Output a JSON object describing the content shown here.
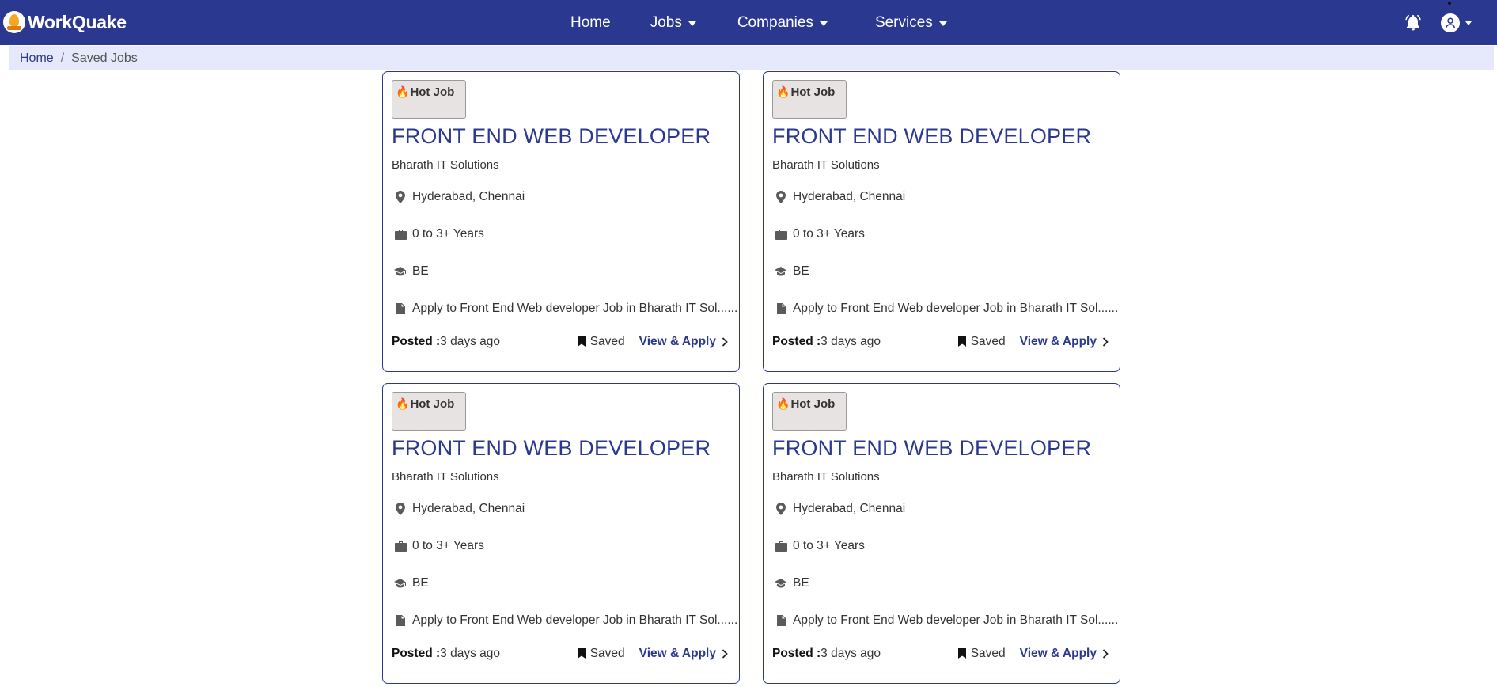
{
  "brand": {
    "name": "WorkQuake"
  },
  "nav": {
    "home": "Home",
    "jobs": "Jobs",
    "companies": "Companies",
    "services": "Services"
  },
  "breadcrumb": {
    "home": "Home",
    "separator": "/",
    "current": "Saved Jobs"
  },
  "colors": {
    "primary": "#2b388f",
    "breadcrumb_bg": "#e6e8fb",
    "badge_bg": "#e8e3e3"
  },
  "icons": {
    "bell": "bell-icon",
    "avatar": "user-avatar-icon",
    "location": "map-pin-icon",
    "experience": "briefcase-icon",
    "education": "graduation-cap-icon",
    "description": "document-icon",
    "saved": "bookmark-icon",
    "apply": "chevron-right-icon"
  },
  "jobs": [
    {
      "badge": "Hot Job",
      "title": "FRONT END WEB DEVELOPER",
      "company": "Bharath IT Solutions",
      "location": "Hyderabad, Chennai",
      "experience": "0 to 3+ Years",
      "education": "BE",
      "description": "Apply to Front End Web developer Job in Bharath IT Sol......",
      "posted_label": "Posted :",
      "posted_value": "3 days ago",
      "saved_label": "Saved",
      "apply_label": "View & Apply"
    },
    {
      "badge": "Hot Job",
      "title": "FRONT END WEB DEVELOPER",
      "company": "Bharath IT Solutions",
      "location": "Hyderabad, Chennai",
      "experience": "0 to 3+ Years",
      "education": "BE",
      "description": "Apply to Front End Web developer Job in Bharath IT Sol......",
      "posted_label": "Posted :",
      "posted_value": "3 days ago",
      "saved_label": "Saved",
      "apply_label": "View & Apply"
    },
    {
      "badge": "Hot Job",
      "title": "FRONT END WEB DEVELOPER",
      "company": "Bharath IT Solutions",
      "location": "Hyderabad, Chennai",
      "experience": "0 to 3+ Years",
      "education": "BE",
      "description": "Apply to Front End Web developer Job in Bharath IT Sol......",
      "posted_label": "Posted :",
      "posted_value": "3 days ago",
      "saved_label": "Saved",
      "apply_label": "View & Apply"
    },
    {
      "badge": "Hot Job",
      "title": "FRONT END WEB DEVELOPER",
      "company": "Bharath IT Solutions",
      "location": "Hyderabad, Chennai",
      "experience": "0 to 3+ Years",
      "education": "BE",
      "description": "Apply to Front End Web developer Job in Bharath IT Sol......",
      "posted_label": "Posted :",
      "posted_value": "3 days ago",
      "saved_label": "Saved",
      "apply_label": "View & Apply"
    }
  ]
}
